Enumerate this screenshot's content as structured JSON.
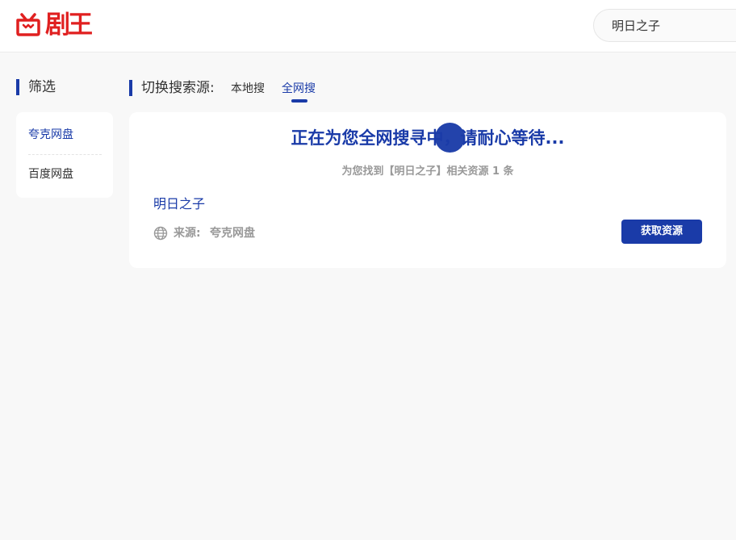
{
  "brand": {
    "logo_text": "剧王",
    "color": "#e02020"
  },
  "search": {
    "value": "明日之子"
  },
  "sidebar": {
    "title": "筛选",
    "items": [
      {
        "label": "夸克网盘",
        "active": true
      },
      {
        "label": "百度网盘",
        "active": false
      }
    ]
  },
  "switch": {
    "label": "切换搜索源:",
    "tabs": [
      {
        "label": "本地搜",
        "active": false
      },
      {
        "label": "全网搜",
        "active": true
      }
    ]
  },
  "results": {
    "status": "正在为您全网搜寻中，请耐心等待...",
    "count_text": "为您找到【明日之子】相关资源 1 条",
    "items": [
      {
        "title": "明日之子",
        "source_prefix": "来源:",
        "source": "夸克网盘",
        "source_icon": "globe-icon",
        "action_label": "获取资源"
      }
    ]
  },
  "colors": {
    "accent": "#1a3ba8",
    "muted": "#999999",
    "background": "#f8f8f8"
  }
}
